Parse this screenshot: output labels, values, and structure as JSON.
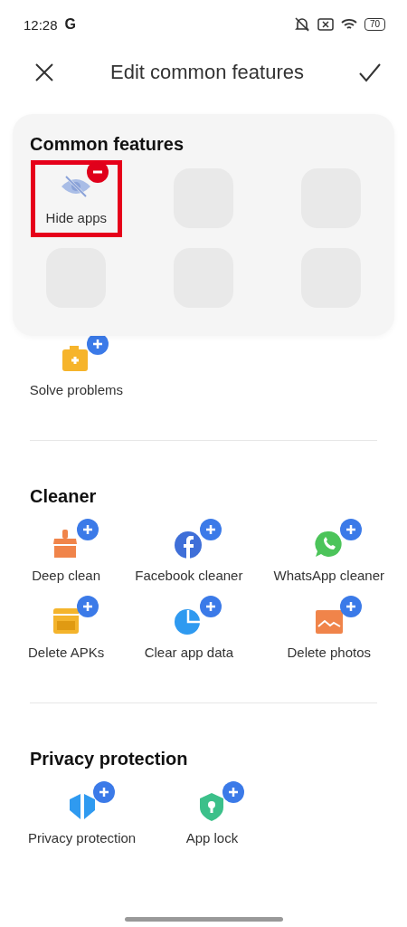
{
  "status_bar": {
    "time": "12:28",
    "carrier": "G",
    "battery": "70"
  },
  "header": {
    "title": "Edit common features"
  },
  "common_features": {
    "title": "Common features",
    "slots": [
      {
        "kind": "eye-off",
        "label": "Hide apps",
        "highlighted": true
      },
      {
        "kind": "empty"
      },
      {
        "kind": "empty"
      },
      {
        "kind": "empty"
      },
      {
        "kind": "empty"
      },
      {
        "kind": "empty"
      }
    ]
  },
  "partial_section": {
    "items": [
      {
        "kind": "first-aid",
        "label": "Solve problems"
      }
    ]
  },
  "sections": [
    {
      "title": "Cleaner",
      "items": [
        {
          "kind": "broom",
          "label": "Deep clean"
        },
        {
          "kind": "facebook",
          "label": "Facebook cleaner"
        },
        {
          "kind": "whatsapp",
          "label": "WhatsApp cleaner"
        },
        {
          "kind": "apk",
          "label": "Delete APKs"
        },
        {
          "kind": "pie",
          "label": "Clear app data"
        },
        {
          "kind": "photo",
          "label": "Delete photos"
        }
      ]
    },
    {
      "title": "Privacy protection",
      "items": [
        {
          "kind": "shield-split",
          "label": "Privacy protection"
        },
        {
          "kind": "lock-shield",
          "label": "App lock"
        }
      ]
    }
  ]
}
